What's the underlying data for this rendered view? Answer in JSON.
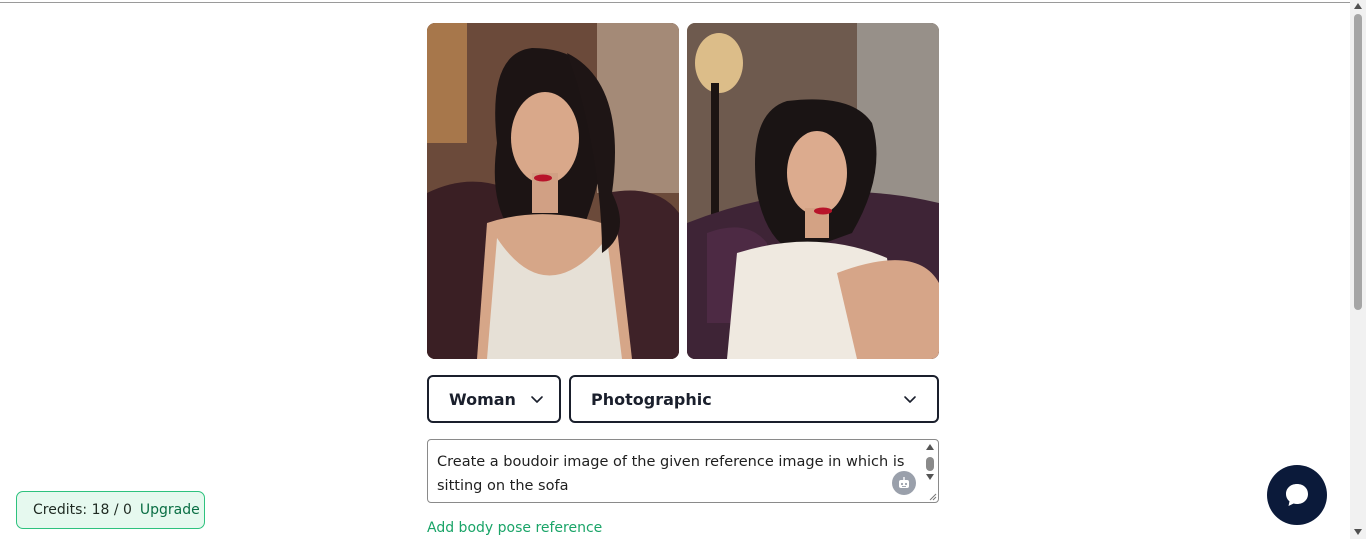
{
  "gallery": {
    "images": [
      {
        "name": "reference-image-1",
        "alt": ""
      },
      {
        "name": "reference-image-2",
        "alt": ""
      }
    ]
  },
  "controls": {
    "gender_select": {
      "selected": "Woman",
      "icon": "chevron-down-icon"
    },
    "style_select": {
      "selected": "Photographic",
      "icon": "chevron-down-icon"
    }
  },
  "prompt": {
    "value": "Create a boudoir image of the given reference image in which is sitting on the sofa",
    "assistant_icon": "robot-icon"
  },
  "pose": {
    "link_label": "Add body pose reference"
  },
  "credits": {
    "label": "Credits: 18 / 0",
    "upgrade_label": "Upgrade"
  },
  "chat": {
    "icon": "chat-bubble-icon"
  },
  "colors": {
    "accent_green": "#1aa468",
    "credits_bg": "#e6f9ef",
    "credits_border": "#2ec27e",
    "chat_bg": "#0b1a3a",
    "select_border": "#1a1f2c"
  }
}
